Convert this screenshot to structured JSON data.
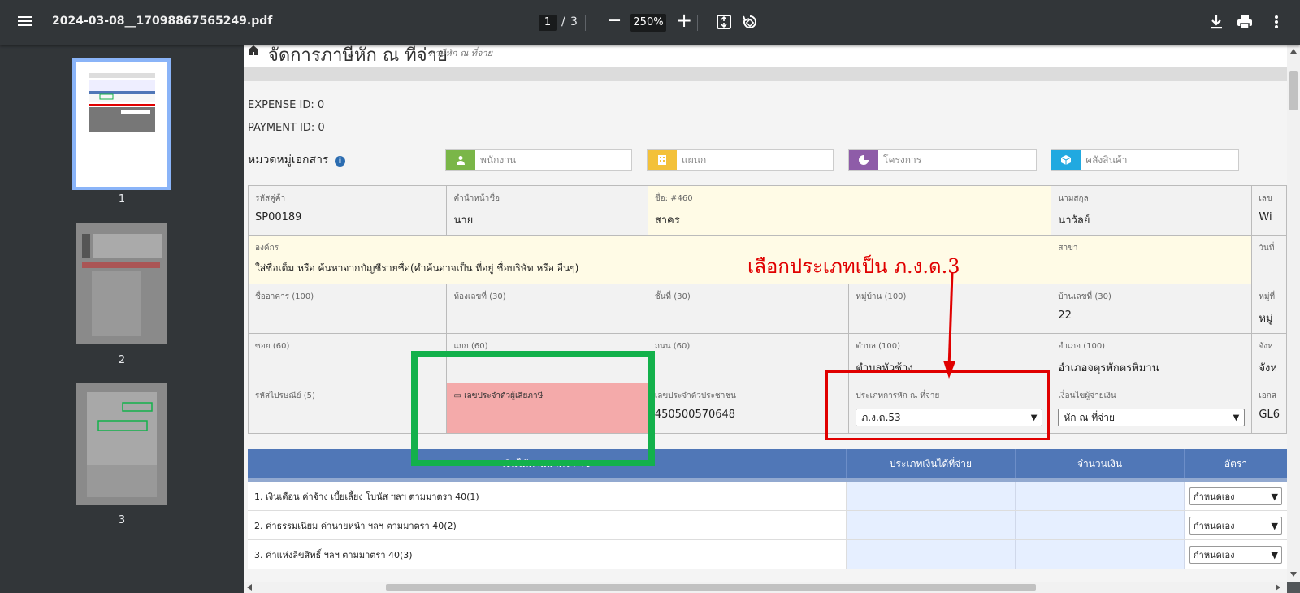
{
  "toolbar": {
    "file_name": "2024-03-08__17098867565249.pdf",
    "current_page": "1",
    "separator": "/",
    "total_pages": "3",
    "minus_label": "−",
    "zoom": "250%",
    "plus_label": "+"
  },
  "sidebar": {
    "thumbnails": [
      {
        "label": "1"
      },
      {
        "label": "2"
      },
      {
        "label": "3"
      }
    ]
  },
  "document": {
    "title": "จัดการภาษีหัก ณ ที่จ่าย",
    "subtitle": "ภาษีหัก ณ ที่จ่าย",
    "expense_id": "EXPENSE ID: 0",
    "payment_id": "PAYMENT ID: 0",
    "category_label": "หมวดหมู่เอกสาร",
    "category_info": "i",
    "categories": [
      {
        "placeholder": "พนักงาน",
        "color": "#7ab648"
      },
      {
        "placeholder": "แผนก",
        "color": "#f3c13a"
      },
      {
        "placeholder": "โครงการ",
        "color": "#8e5ca8"
      },
      {
        "placeholder": "คลังสินค้า",
        "color": "#21a9e0"
      }
    ],
    "row1": {
      "code_label": "รหัสคู่ค้า",
      "code_value": "SP00189",
      "prefix_label": "คำนำหน้าชื่อ",
      "prefix_value": "นาย",
      "name_label": "ชื่อ: #460",
      "name_value": "สาคร",
      "surname_label": "นามสกุล",
      "surname_value": "นาวัลย์",
      "extra_label": "เลข",
      "extra_value": "Wi"
    },
    "row2": {
      "org_label": "องค์กร",
      "org_hint": "ใส่ชื่อเต็ม หรือ ค้นหาจากบัญชีรายชื่อ(คำค้นอาจเป็น ที่อยู่ ชื่อบริษัท หรือ อื่นๆ)",
      "branch_label": "สาขา",
      "extra_label": "วันที่"
    },
    "row3": {
      "building_label": "ชื่ออาคาร (100)",
      "room_label": "ห้องเลขที่ (30)",
      "floor_label": "ชั้นที่ (30)",
      "village_label": "หมู่บ้าน (100)",
      "house_label": "บ้านเลขที่ (30)",
      "house_value": "22",
      "extra_label": "หมู่ที่",
      "extra_value": "หมู่"
    },
    "row4": {
      "soi_label": "ซอย (60)",
      "yaek_label": "แยก (60)",
      "road_label": "ถนน (60)",
      "subdistrict_label": "ตำบล (100)",
      "subdistrict_value": "ตำบลหัวช้าง",
      "district_label": "อำเภอ (100)",
      "district_value": "อำเภอจตุรพักตรพิมาน",
      "extra_label": "จังห",
      "extra_value": "จังห"
    },
    "row5": {
      "postal_label": "รหัสไปรษณีย์ (5)",
      "taxid_label": "เลขประจำตัวผู้เสียภาษี",
      "citizen_label": "เลขประจำตัวประชาชน",
      "citizen_value": "450500570648",
      "wht_type_label": "ประเภทการหัก ณ ที่จ่าย",
      "wht_type_value": "ภ.ง.ด.53",
      "condition_label": "เงื่อนไขผู้จ่ายเงิน",
      "condition_value": "หัก ณ ที่จ่าย",
      "extra_label": "เอกส",
      "extra_value": "GL6"
    },
    "rate_table": {
      "headers": [
        "เงินได้ตามมาตรา 40",
        "ประเภทเงินได้ที่จ่าย",
        "จำนวนเงิน",
        "อัตรา"
      ],
      "rows": [
        {
          "label": "1. เงินเดือน ค่าจ้าง เบี้ยเลี้ยง โบนัส ฯลฯ ตามมาตรา 40(1)",
          "rate": "กำหนดเอง"
        },
        {
          "label": "2. ค่าธรรมเนียม ค่านายหน้า ฯลฯ ตามมาตรา 40(2)",
          "rate": "กำหนดเอง"
        },
        {
          "label": "3. ค่าแห่งลิขสิทธิ์ ฯลฯ ตามมาตรา 40(3)",
          "rate": "กำหนดเอง"
        }
      ]
    },
    "annotation": "เลือกประเภทเป็น ภ.ง.ด.3"
  },
  "colors": {
    "toolbar_bg": "#323639",
    "annotation_red": "#e00000",
    "highlight_green": "#13b14b",
    "table_header_blue": "#5077b7"
  }
}
